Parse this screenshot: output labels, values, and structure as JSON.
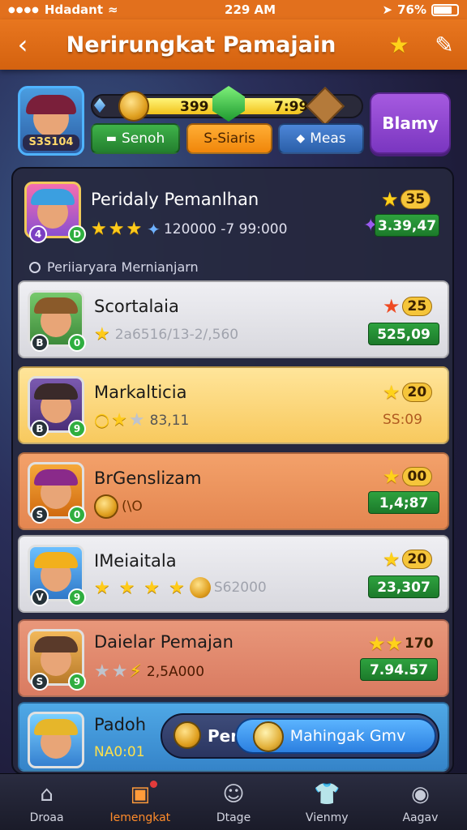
{
  "status": {
    "carrier": "Hdadant",
    "time": "229 AM",
    "battery": "76%"
  },
  "header": {
    "title": "Nerirungkat Pamajain",
    "back_icon": "back-arrow-icon",
    "star_icon": "star-icon",
    "edit_icon": "edit-icon"
  },
  "profile": {
    "level_text": "S3S104",
    "currency_left": "399",
    "currency_right": "7:990",
    "currency_fill_percent": 78,
    "buttons": {
      "search": "Senoh",
      "signs": "S-Siaris",
      "meas": "Meas"
    },
    "play_label": "Blamy"
  },
  "featured": {
    "name": "Peridaly Pemanlhan",
    "sub": "120000 -7 99:000",
    "rank": "35",
    "score": "3.39,47"
  },
  "section_label": "Periiaryara Mernianjarn",
  "rows": [
    {
      "name": "Scortalaia",
      "sub": "2a6516/13-2/,560",
      "rank": "25",
      "score": "525,09",
      "avatar_badge": "B",
      "avatar_badge2": "0"
    },
    {
      "name": "Markalticia",
      "sub": "83,11",
      "rank": "20",
      "score": "SS:09",
      "avatar_badge": "B",
      "avatar_badge2": "9"
    },
    {
      "name": "BrGenslizam",
      "sub": "(\\O",
      "rank": "00",
      "score": "1,4;87",
      "avatar_badge": "S",
      "avatar_badge2": "0"
    },
    {
      "name": "IMeiaitala",
      "sub": "S62000",
      "rank": "20",
      "score": "23,307",
      "avatar_badge": "V",
      "avatar_badge2": "9"
    },
    {
      "name": "Daielar Pemajan",
      "sub": "2,5A000",
      "rank": "170",
      "score": "7.94.57",
      "avatar_badge": "S",
      "avatar_badge2": "9"
    }
  ],
  "bottom_row": {
    "name": "Padoh",
    "sub": "NA0:01",
    "pill_label": "Per",
    "pill_button": "Mahingak Gmv"
  },
  "tabs": [
    {
      "label": "Droaa",
      "icon": "home-icon"
    },
    {
      "label": "Iemengkat",
      "icon": "ranking-icon",
      "active": true
    },
    {
      "label": "Dtage",
      "icon": "smiley-icon"
    },
    {
      "label": "Vienmy",
      "icon": "shirt-icon"
    },
    {
      "label": "Aagav",
      "icon": "profile-icon"
    }
  ],
  "colors": {
    "header": "#e2701d",
    "accent_green": "#2ea23f",
    "play_purple": "#8a45d0"
  }
}
